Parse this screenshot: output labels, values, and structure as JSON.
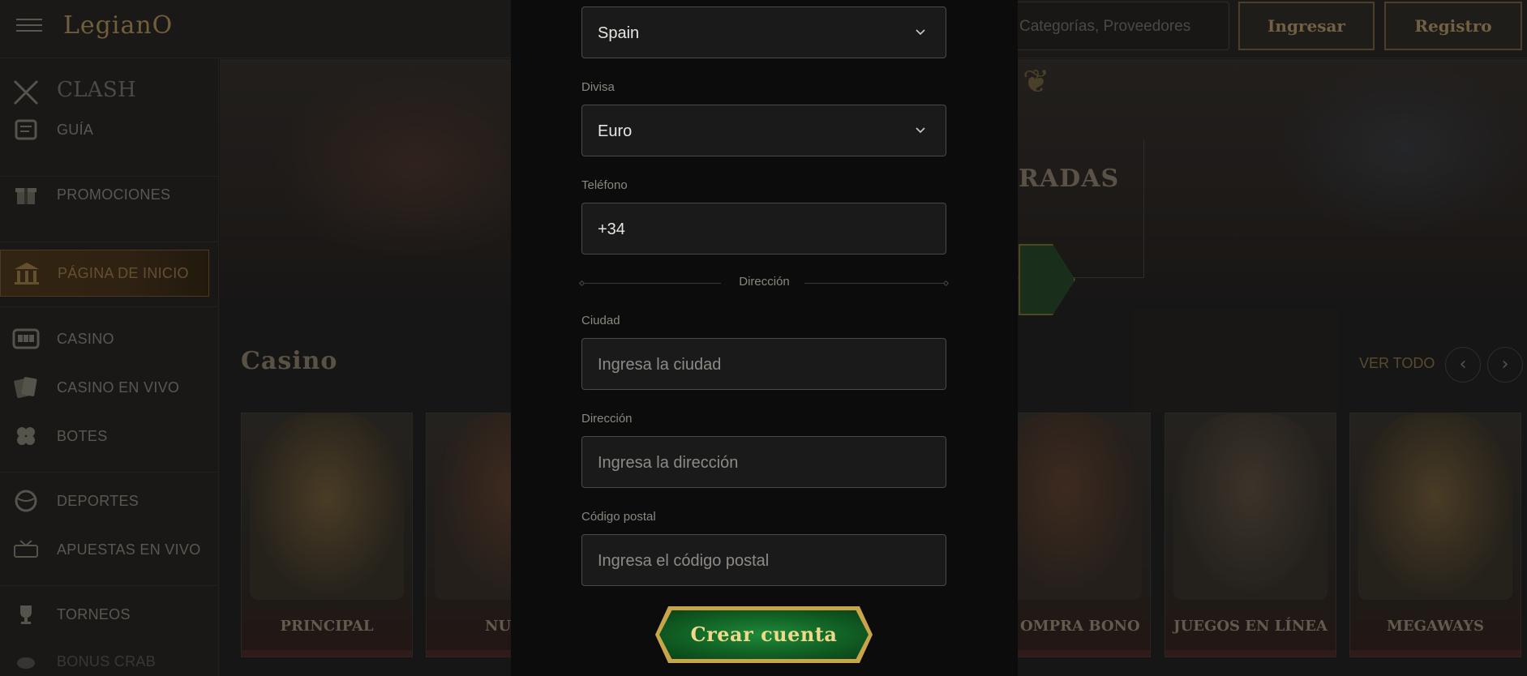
{
  "header": {
    "logo": "LegianO",
    "search_placeholder": "Categorías, Proveedores",
    "login_label": "Ingresar",
    "register_label": "Registro"
  },
  "sidebar": {
    "items": [
      {
        "label": "CLASH",
        "icon": "crossed-swords-icon"
      },
      {
        "label": "GUÍA",
        "icon": "scroll-icon"
      },
      {
        "label": "PROMOCIONES",
        "icon": "gift-icon"
      },
      {
        "label": "PÁGINA DE INICIO",
        "icon": "temple-icon",
        "active": true
      },
      {
        "label": "CASINO",
        "icon": "slot-machine-icon"
      },
      {
        "label": "CASINO EN VIVO",
        "icon": "cards-icon"
      },
      {
        "label": "BOTES",
        "icon": "clover-icon"
      },
      {
        "label": "DEPORTES",
        "icon": "ball-icon"
      },
      {
        "label": "APUESTAS EN VIVO",
        "icon": "live-icon"
      },
      {
        "label": "TORNEOS",
        "icon": "trophy-icon"
      },
      {
        "label": "BONUS CRAB",
        "icon": "crab-icon"
      }
    ]
  },
  "hero": {
    "partial_text": "RADAS"
  },
  "casino": {
    "title": "Casino",
    "see_all": "VER TODO",
    "cards": [
      {
        "label": "PRINCIPAL"
      },
      {
        "label": "NU"
      },
      {
        "label": "OMPRA BONO"
      },
      {
        "label": "JUEGOS EN LÍNEA"
      },
      {
        "label": "MEGAWAYS"
      }
    ]
  },
  "form": {
    "country_value": "Spain",
    "currency_label": "Divisa",
    "currency_value": "Euro",
    "phone_label": "Teléfono",
    "phone_value": "+34",
    "address_section": "Dirección",
    "city_label": "Ciudad",
    "city_placeholder": "Ingresa la ciudad",
    "address_label": "Dirección",
    "address_placeholder": "Ingresa la dirección",
    "postal_label": "Código postal",
    "postal_placeholder": "Ingresa el código postal",
    "submit_label": "Crear cuenta"
  },
  "colors": {
    "accent_gold": "#c8a54a",
    "button_green": "#116124",
    "modal_bg": "#0c0c0c"
  }
}
